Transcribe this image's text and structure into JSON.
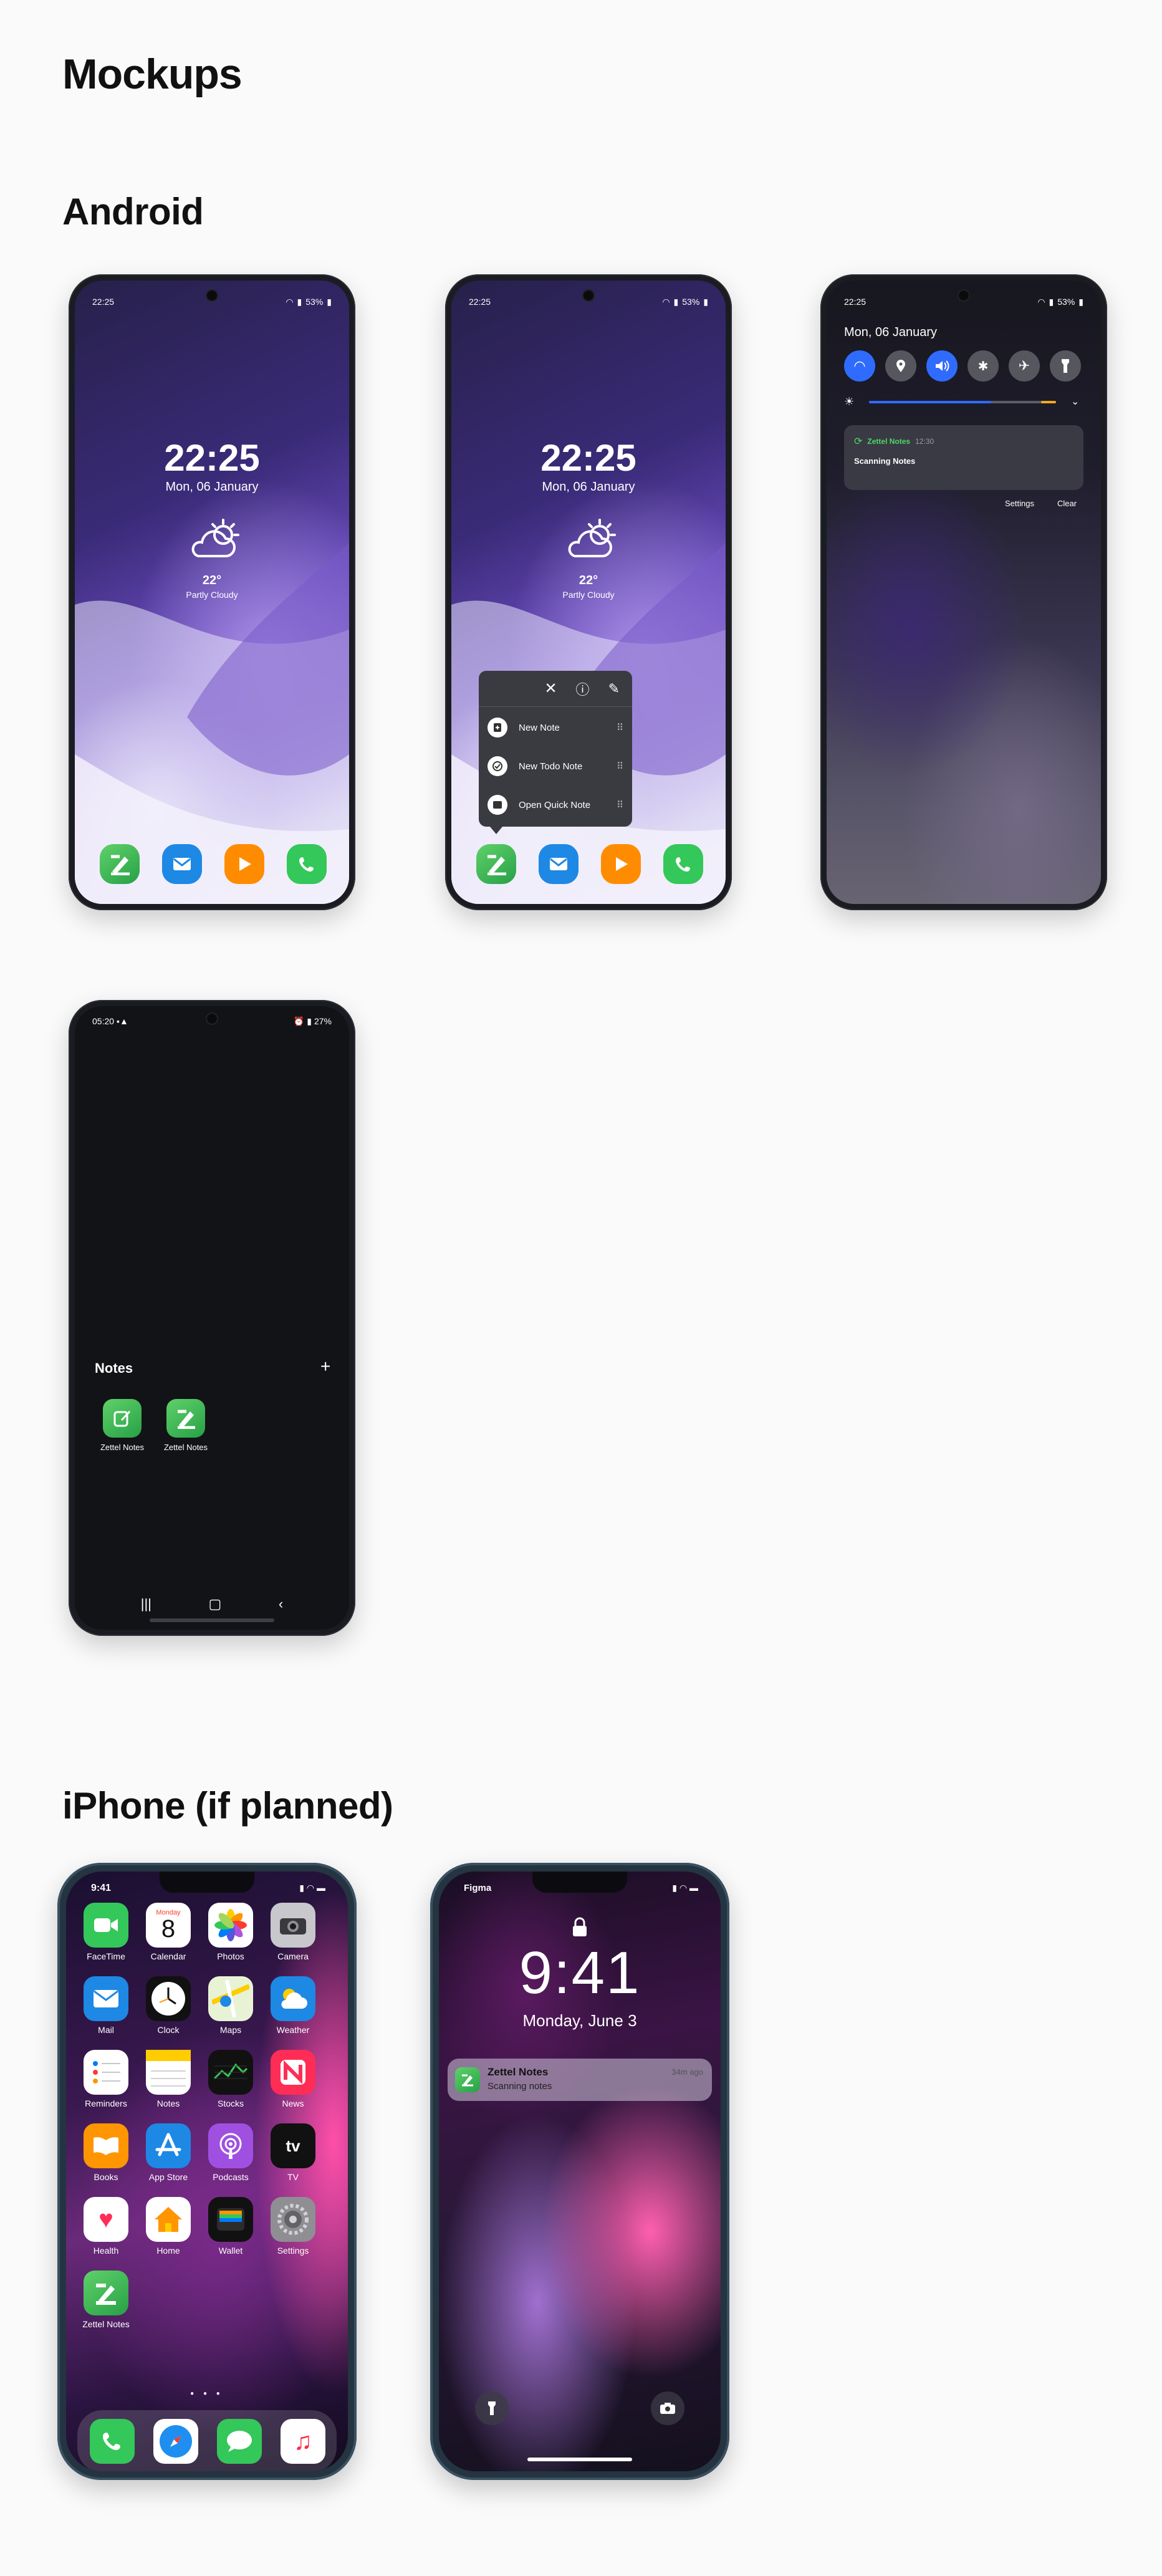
{
  "page": {
    "title": "Mockups",
    "sections": {
      "android": "Android",
      "iphone": "iPhone (if planned)"
    }
  },
  "android_lock": {
    "status_time": "22:25",
    "battery": "53%",
    "clock_time": "22:25",
    "date": "Mon, 06 January",
    "temperature": "22°",
    "weather_desc": "Partly Cloudy"
  },
  "android_popup": {
    "status_time": "22:25",
    "battery": "53%",
    "clock_time": "22:25",
    "date": "Mon, 06 January",
    "temperature": "22°",
    "weather_desc": "Partly Cloudy",
    "menu": [
      "New Note",
      "New Todo Note",
      "Open Quick Note"
    ]
  },
  "android_shade": {
    "status_time": "22:25",
    "battery": "53%",
    "date": "Mon, 06 January",
    "notification": {
      "app": "Zettel Notes",
      "time": "12:30",
      "body": "Scanning Notes"
    },
    "actions": {
      "settings": "Settings",
      "clear": "Clear"
    },
    "colors": {
      "accent": "#2f6bff",
      "brightness_end": "#f5a623",
      "app_green": "#4cd964"
    }
  },
  "android_widget": {
    "status_time": "05:20",
    "battery": "27%",
    "folder_title": "Notes",
    "add_symbol": "+",
    "apps": [
      "Zettel Notes",
      "Zettel Notes"
    ]
  },
  "iphone_home": {
    "status_time": "9:41",
    "calendar_day": "Monday",
    "calendar_date": "8",
    "apps": [
      "FaceTime",
      "Calendar",
      "Photos",
      "Camera",
      "Mail",
      "Clock",
      "Maps",
      "Weather",
      "Reminders",
      "Notes",
      "Stocks",
      "News",
      "Books",
      "App Store",
      "Podcasts",
      "TV",
      "Health",
      "Home",
      "Wallet",
      "Settings",
      "Zettel Notes"
    ],
    "tv_label": "tv"
  },
  "iphone_lock": {
    "carrier": "Figma",
    "time": "9:41",
    "date": "Monday, June 3",
    "notification": {
      "title": "Zettel Notes",
      "body": "Scanning notes",
      "time": "34m ago"
    }
  }
}
